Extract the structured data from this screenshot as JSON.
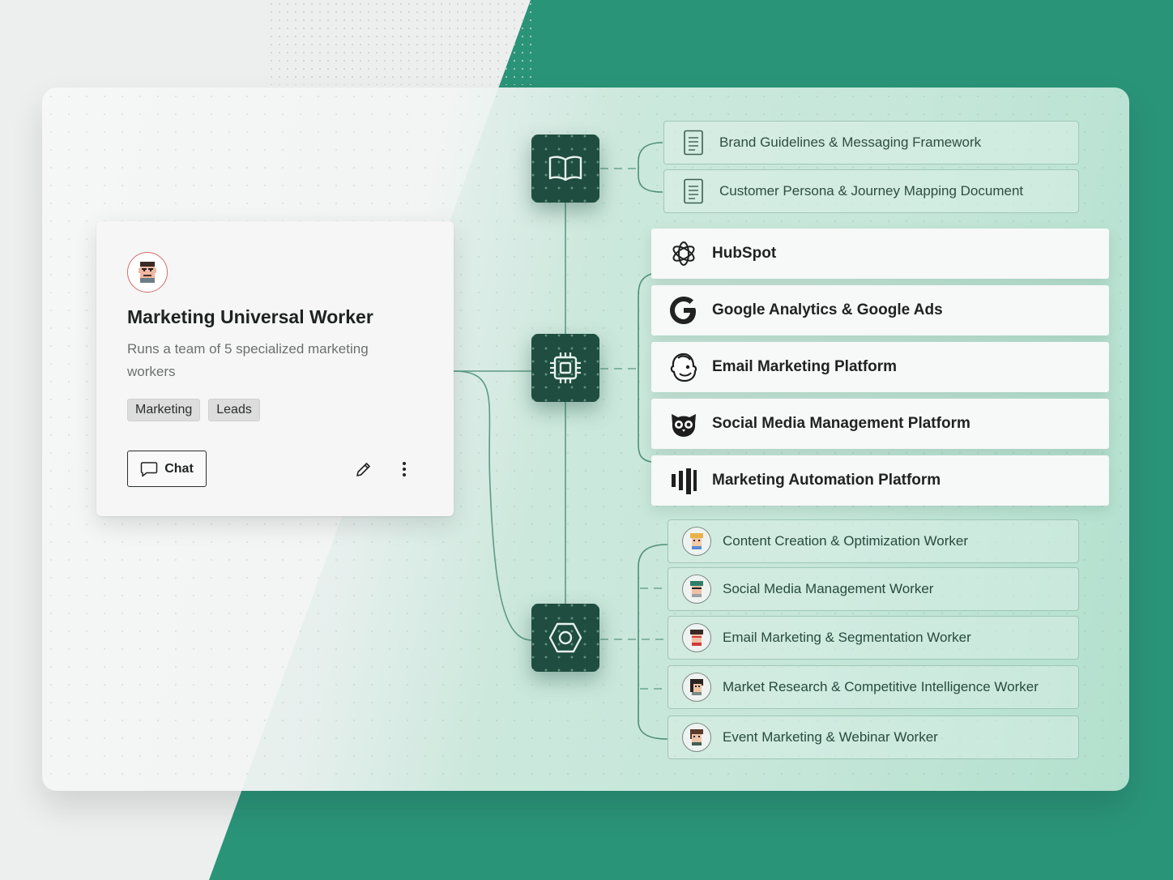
{
  "colors": {
    "brand_green": "#2a9478",
    "hub_dark": "#1f4d3f",
    "card_bg": "#f6f6f6"
  },
  "worker": {
    "name": "Marketing Universal Worker",
    "description": "Runs a team of 5 specialized marketing workers",
    "tags": [
      "Marketing",
      "Leads"
    ],
    "chat_label": "Chat",
    "avatar_icon": "pixel-avatar-icon",
    "edit_icon": "pencil-icon",
    "more_icon": "more-vertical-icon"
  },
  "hubs": [
    {
      "icon": "book-icon"
    },
    {
      "icon": "chip-icon"
    },
    {
      "icon": "hexagon-icon"
    }
  ],
  "knowledge": [
    {
      "label": "Brand Guidelines & Messaging Framework",
      "icon": "document-icon"
    },
    {
      "label": "Customer Persona & Journey Mapping Document",
      "icon": "document-icon"
    }
  ],
  "tools": [
    {
      "label": "HubSpot",
      "icon": "openai-knot-icon"
    },
    {
      "label": "Google Analytics & Google Ads",
      "icon": "google-g-icon"
    },
    {
      "label": "Email Marketing Platform",
      "icon": "mailchimp-icon"
    },
    {
      "label": "Social Media Management Platform",
      "icon": "owl-icon"
    },
    {
      "label": "Marketing Automation Platform",
      "icon": "bars-logo-icon"
    }
  ],
  "workers": [
    {
      "label": "Content Creation & Optimization Worker",
      "icon": "worker-avatar-icon"
    },
    {
      "label": "Social Media Management Worker",
      "icon": "worker-avatar-icon"
    },
    {
      "label": "Email Marketing & Segmentation Worker",
      "icon": "worker-avatar-icon"
    },
    {
      "label": "Market Research & Competitive Intelligence Worker",
      "icon": "worker-avatar-icon"
    },
    {
      "label": "Event Marketing & Webinar Worker",
      "icon": "worker-avatar-icon"
    }
  ]
}
